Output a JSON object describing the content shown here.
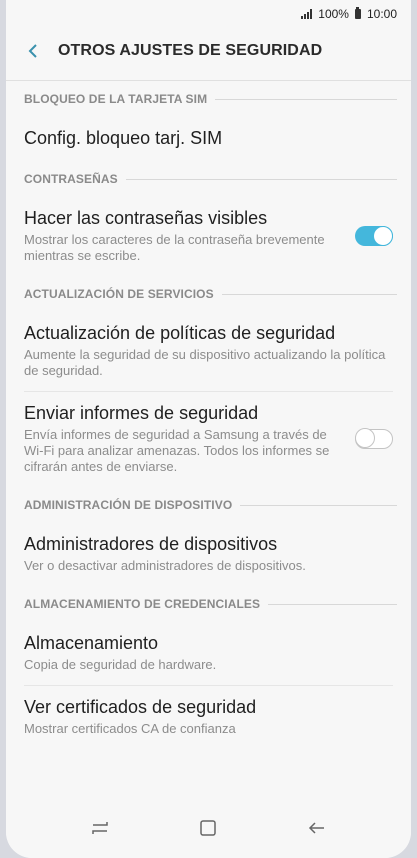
{
  "status": {
    "battery": "100%",
    "time": "10:00"
  },
  "appbar": {
    "title": "OTROS AJUSTES DE SEGURIDAD"
  },
  "sections": {
    "sim": "BLOQUEO DE LA TARJETA SIM",
    "passwords": "CONTRASEÑAS",
    "updates": "ACTUALIZACIÓN DE SERVICIOS",
    "device_admin": "ADMINISTRACIÓN DE DISPOSITIVO",
    "credentials": "ALMACENAMIENTO DE CREDENCIALES"
  },
  "items": {
    "sim_lock": {
      "title": "Config. bloqueo tarj. SIM"
    },
    "show_passwords": {
      "title": "Hacer las contraseñas visibles",
      "subtitle": "Mostrar los caracteres de la contraseña brevemente mientras se escribe.",
      "toggle": "on"
    },
    "policy_update": {
      "title": "Actualización de políticas de seguridad",
      "subtitle": "Aumente la seguridad de su dispositivo actualizando la política de seguridad."
    },
    "security_reports": {
      "title": "Enviar informes de seguridad",
      "subtitle": "Envía informes de seguridad a Samsung a través de Wi-Fi para analizar amenazas. Todos los informes se cifrarán antes de enviarse.",
      "toggle": "off"
    },
    "device_admins": {
      "title": "Administradores de dispositivos",
      "subtitle": "Ver o desactivar administradores de dispositivos."
    },
    "storage": {
      "title": "Almacenamiento",
      "subtitle": "Copia de seguridad de hardware."
    },
    "certificates": {
      "title": "Ver certificados de seguridad",
      "subtitle": "Mostrar certificados CA de confianza"
    }
  },
  "colors": {
    "accent": "#44b7dc",
    "section_text": "#8a8a8a"
  },
  "icons": {
    "back": "back-arrow-icon",
    "recent": "recent-apps-icon",
    "home": "home-icon",
    "nav_back": "nav-back-icon"
  }
}
